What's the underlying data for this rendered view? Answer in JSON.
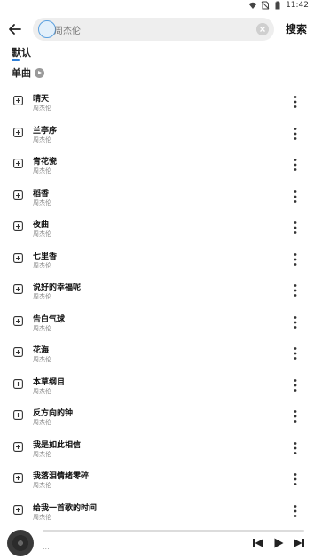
{
  "status": {
    "time": "11:42"
  },
  "search": {
    "value": "周杰伦",
    "button_label": "搜索"
  },
  "tabs": [
    {
      "label": "默认"
    }
  ],
  "section": {
    "title": "单曲"
  },
  "songs": [
    {
      "title": "晴天",
      "artist": "周杰伦"
    },
    {
      "title": "兰亭序",
      "artist": "周杰伦"
    },
    {
      "title": "青花瓷",
      "artist": "周杰伦"
    },
    {
      "title": "稻香",
      "artist": "周杰伦"
    },
    {
      "title": "夜曲",
      "artist": "周杰伦"
    },
    {
      "title": "七里香",
      "artist": "周杰伦"
    },
    {
      "title": "说好的幸福呢",
      "artist": "周杰伦"
    },
    {
      "title": "告白气球",
      "artist": "周杰伦"
    },
    {
      "title": "花海",
      "artist": "周杰伦"
    },
    {
      "title": "本草纲目",
      "artist": "周杰伦"
    },
    {
      "title": "反方向的钟",
      "artist": "周杰伦"
    },
    {
      "title": "我是如此相信",
      "artist": "周杰伦"
    },
    {
      "title": "我落泪情绪零碎",
      "artist": "周杰伦"
    },
    {
      "title": "给我一首歌的时间",
      "artist": "周杰伦"
    }
  ],
  "player": {
    "track_text": "..."
  },
  "colors": {
    "accent": "#2f7fd6",
    "text": "#111111",
    "muted": "#888888",
    "search_bg": "#eeeeee"
  }
}
